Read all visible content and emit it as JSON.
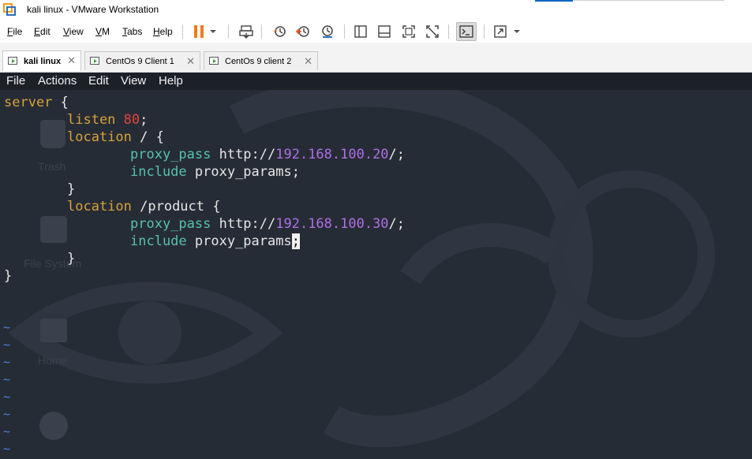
{
  "window": {
    "title": "kali linux - VMware Workstation"
  },
  "vmware_menu": [
    {
      "label": "File",
      "u": "F",
      "rest": "ile"
    },
    {
      "label": "Edit",
      "u": "E",
      "rest": "dit"
    },
    {
      "label": "View",
      "u": "V",
      "rest": "iew"
    },
    {
      "label": "VM",
      "u": "V",
      "rest": "M"
    },
    {
      "label": "Tabs",
      "u": "T",
      "rest": "abs"
    },
    {
      "label": "Help",
      "u": "H",
      "rest": "elp"
    }
  ],
  "toolbar_icons": [
    "pause-icon",
    "dropdown-arrow-icon",
    "send-ctrl-alt-del-icon",
    "snapshot-icon",
    "revert-snapshot-icon",
    "snapshot-manager-icon",
    "show-library-icon",
    "thumbnail-bar-icon",
    "full-screen-icon",
    "unity-icon",
    "console-view-icon",
    "stretch-guest-icon",
    "dropdown-arrow-icon"
  ],
  "tabs": [
    {
      "label": "kali linux",
      "active": true
    },
    {
      "label": "CentOs 9 Client 1",
      "active": false
    },
    {
      "label": "CentOs 9 client 2",
      "active": false
    }
  ],
  "guest_menu": [
    "File",
    "Actions",
    "Edit",
    "View",
    "Help"
  ],
  "desktop_labels": [
    "Trash",
    "File System",
    "Home"
  ],
  "editor": {
    "line1_kw": "server",
    "line1_rest": " {",
    "line2_kw": "listen",
    "line2_num": "80",
    "line2_end": ";",
    "line3_kw": "location",
    "line3_rest": " / {",
    "line4_kw": "proxy_pass",
    "line4_proto": " http://",
    "line4_ip": "192.168.100.20",
    "line4_end": "/;",
    "line5_kw": "include",
    "line5_rest": " proxy_params;",
    "line6": "}",
    "line7_kw": "location",
    "line7_rest": " /product {",
    "line8_kw": "proxy_pass",
    "line8_proto": " http://",
    "line8_ip": "192.168.100.30",
    "line8_end": "/;",
    "line9_kw": "include",
    "line9_rest": " proxy_params",
    "line9_cursor": ";",
    "line10": "}",
    "line11": "}",
    "tilde": "~"
  }
}
